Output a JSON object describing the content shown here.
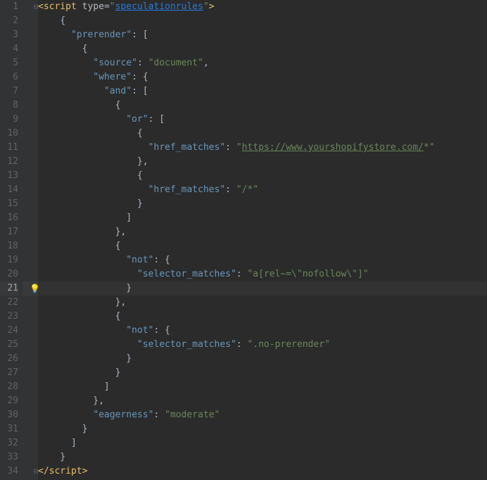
{
  "editor": {
    "current_line": 21,
    "fold_open_line": 1,
    "fold_close_line": 34,
    "bulb_line": 21,
    "line_count": 34
  },
  "code": {
    "lines": [
      [
        {
          "t": "<",
          "c": "tag"
        },
        {
          "t": "script ",
          "c": "tag"
        },
        {
          "t": "type",
          "c": "attr"
        },
        {
          "t": "=",
          "c": "punct"
        },
        {
          "t": "\"",
          "c": "str"
        },
        {
          "t": "speculationrules",
          "c": "str-spec"
        },
        {
          "t": "\"",
          "c": "str"
        },
        {
          "t": ">",
          "c": "tag"
        }
      ],
      [
        {
          "t": "    {",
          "c": "punct"
        }
      ],
      [
        {
          "t": "      ",
          "c": "punct"
        },
        {
          "t": "\"prerender\"",
          "c": "key"
        },
        {
          "t": ": [",
          "c": "punct"
        }
      ],
      [
        {
          "t": "        {",
          "c": "punct"
        }
      ],
      [
        {
          "t": "          ",
          "c": "punct"
        },
        {
          "t": "\"source\"",
          "c": "key"
        },
        {
          "t": ": ",
          "c": "punct"
        },
        {
          "t": "\"document\"",
          "c": "str"
        },
        {
          "t": ",",
          "c": "punct"
        }
      ],
      [
        {
          "t": "          ",
          "c": "punct"
        },
        {
          "t": "\"where\"",
          "c": "key"
        },
        {
          "t": ": {",
          "c": "punct"
        }
      ],
      [
        {
          "t": "            ",
          "c": "punct"
        },
        {
          "t": "\"and\"",
          "c": "key"
        },
        {
          "t": ": [",
          "c": "punct"
        }
      ],
      [
        {
          "t": "              {",
          "c": "punct"
        }
      ],
      [
        {
          "t": "                ",
          "c": "punct"
        },
        {
          "t": "\"or\"",
          "c": "key"
        },
        {
          "t": ": [",
          "c": "punct"
        }
      ],
      [
        {
          "t": "                  {",
          "c": "punct"
        }
      ],
      [
        {
          "t": "                    ",
          "c": "punct"
        },
        {
          "t": "\"href_matches\"",
          "c": "key"
        },
        {
          "t": ": ",
          "c": "punct"
        },
        {
          "t": "\"",
          "c": "str"
        },
        {
          "t": "https://www.yourshopifystore.com/",
          "c": "str-u"
        },
        {
          "t": "*\"",
          "c": "str"
        }
      ],
      [
        {
          "t": "                  },",
          "c": "punct"
        }
      ],
      [
        {
          "t": "                  {",
          "c": "punct"
        }
      ],
      [
        {
          "t": "                    ",
          "c": "punct"
        },
        {
          "t": "\"href_matches\"",
          "c": "key"
        },
        {
          "t": ": ",
          "c": "punct"
        },
        {
          "t": "\"/*\"",
          "c": "str"
        }
      ],
      [
        {
          "t": "                  }",
          "c": "punct"
        }
      ],
      [
        {
          "t": "                ]",
          "c": "punct"
        }
      ],
      [
        {
          "t": "              },",
          "c": "punct"
        }
      ],
      [
        {
          "t": "              {",
          "c": "punct"
        }
      ],
      [
        {
          "t": "                ",
          "c": "punct"
        },
        {
          "t": "\"not\"",
          "c": "key"
        },
        {
          "t": ": {",
          "c": "punct"
        }
      ],
      [
        {
          "t": "                  ",
          "c": "punct"
        },
        {
          "t": "\"selector_matches\"",
          "c": "key"
        },
        {
          "t": ": ",
          "c": "punct"
        },
        {
          "t": "\"a[rel~=\\\"nofollow\\\"]\"",
          "c": "str"
        }
      ],
      [
        {
          "t": "                }",
          "c": "punct"
        }
      ],
      [
        {
          "t": "              },",
          "c": "punct"
        }
      ],
      [
        {
          "t": "              {",
          "c": "punct"
        }
      ],
      [
        {
          "t": "                ",
          "c": "punct"
        },
        {
          "t": "\"not\"",
          "c": "key"
        },
        {
          "t": ": {",
          "c": "punct"
        }
      ],
      [
        {
          "t": "                  ",
          "c": "punct"
        },
        {
          "t": "\"selector_matches\"",
          "c": "key"
        },
        {
          "t": ": ",
          "c": "punct"
        },
        {
          "t": "\".no-prerender\"",
          "c": "str"
        }
      ],
      [
        {
          "t": "                }",
          "c": "punct"
        }
      ],
      [
        {
          "t": "              }",
          "c": "punct"
        }
      ],
      [
        {
          "t": "            ]",
          "c": "punct"
        }
      ],
      [
        {
          "t": "          },",
          "c": "punct"
        }
      ],
      [
        {
          "t": "          ",
          "c": "punct"
        },
        {
          "t": "\"eagerness\"",
          "c": "key"
        },
        {
          "t": ": ",
          "c": "punct"
        },
        {
          "t": "\"moderate\"",
          "c": "str"
        }
      ],
      [
        {
          "t": "        }",
          "c": "punct"
        }
      ],
      [
        {
          "t": "      ]",
          "c": "punct"
        }
      ],
      [
        {
          "t": "    }",
          "c": "punct"
        }
      ],
      [
        {
          "t": "</",
          "c": "tag"
        },
        {
          "t": "script",
          "c": "tag"
        },
        {
          "t": ">",
          "c": "tag"
        }
      ]
    ]
  }
}
